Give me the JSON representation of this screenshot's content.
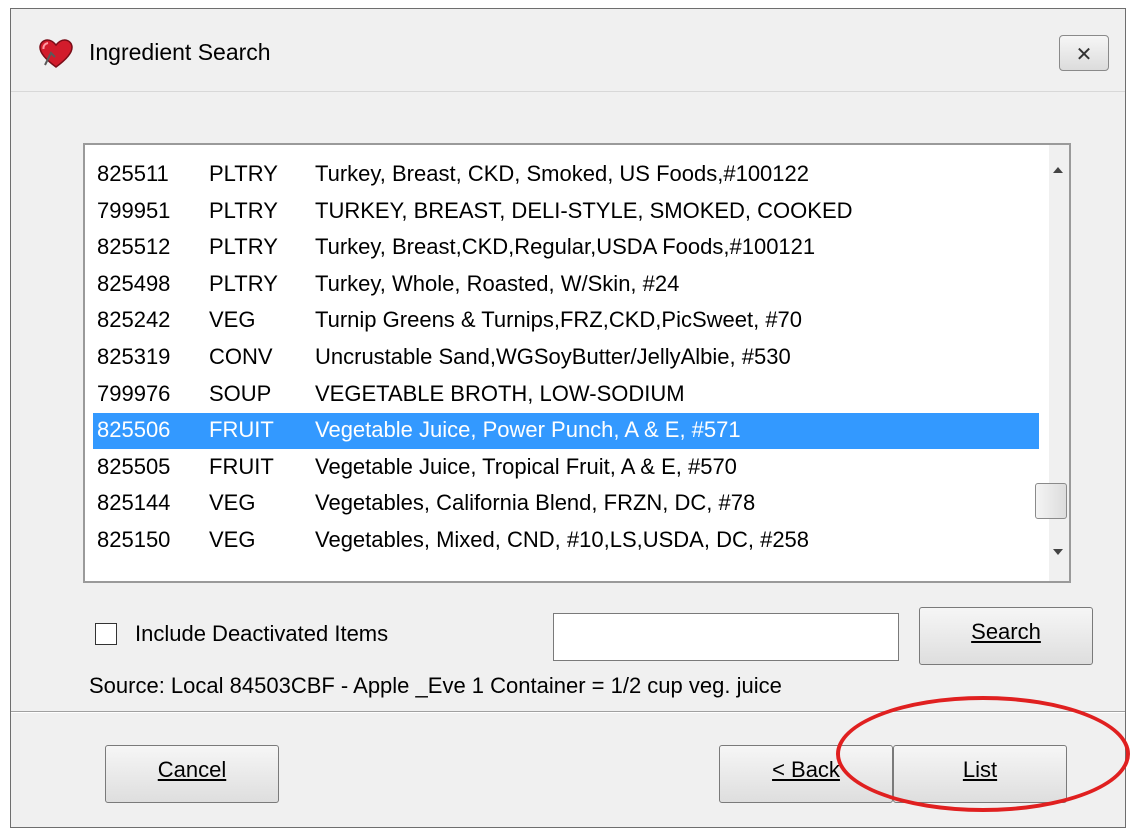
{
  "window": {
    "title": "Ingredient Search",
    "close_symbol": "✕"
  },
  "items": [
    {
      "code": "825511",
      "category": "PLTRY",
      "description": "Turkey, Breast, CKD, Smoked, US Foods,#100122"
    },
    {
      "code": "799951",
      "category": "PLTRY",
      "description": "TURKEY, BREAST, DELI-STYLE, SMOKED, COOKED"
    },
    {
      "code": "825512",
      "category": "PLTRY",
      "description": "Turkey, Breast,CKD,Regular,USDA Foods,#100121"
    },
    {
      "code": "825498",
      "category": "PLTRY",
      "description": "Turkey, Whole, Roasted, W/Skin, #24"
    },
    {
      "code": "825242",
      "category": "VEG",
      "description": "Turnip Greens & Turnips,FRZ,CKD,PicSweet, #70"
    },
    {
      "code": "825319",
      "category": "CONV",
      "description": "Uncrustable Sand,WGSoyButter/JellyAlbie, #530"
    },
    {
      "code": "799976",
      "category": "SOUP",
      "description": "VEGETABLE BROTH, LOW-SODIUM"
    },
    {
      "code": "825506",
      "category": "FRUIT",
      "description": "Vegetable Juice, Power Punch, A & E, #571"
    },
    {
      "code": "825505",
      "category": "FRUIT",
      "description": "Vegetable Juice, Tropical Fruit, A & E, #570"
    },
    {
      "code": "825144",
      "category": "VEG",
      "description": "Vegetables, California Blend, FRZN, DC, #78"
    },
    {
      "code": "825150",
      "category": "VEG",
      "description": "Vegetables, Mixed, CND, #10,LS,USDA, DC, #258"
    }
  ],
  "selected_index": 7,
  "include_deactivated": {
    "label": "Include Deactivated Items",
    "checked": false
  },
  "search": {
    "value": "",
    "button_label": "Search"
  },
  "source_line": "Source: Local  84503CBF - Apple _Eve  1 Container = 1/2 cup veg. juice",
  "buttons": {
    "cancel": "Cancel",
    "back": "< Back",
    "list": "List"
  },
  "colors": {
    "selection": "#3399ff",
    "annotation": "#e02020"
  }
}
